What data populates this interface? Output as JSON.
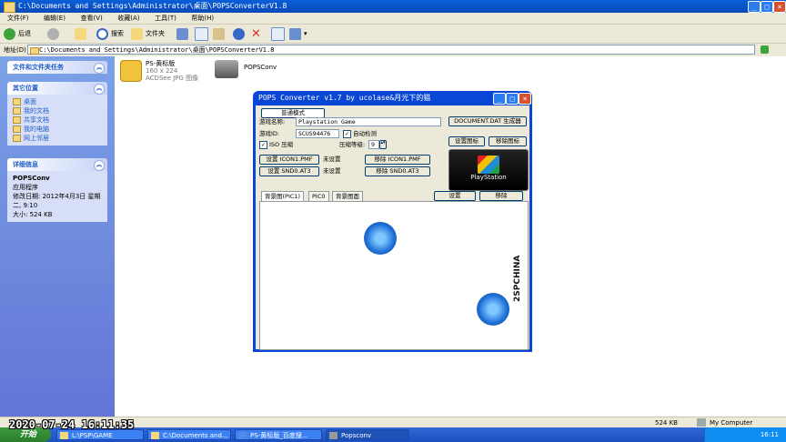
{
  "window": {
    "title": "C:\\Documents and Settings\\Administrator\\桌面\\POPSConverterV1.8"
  },
  "menu": [
    "文件(F)",
    "编辑(E)",
    "查看(V)",
    "收藏(A)",
    "工具(T)",
    "帮助(H)"
  ],
  "toolbar": {
    "back": "后退",
    "search": "搜索",
    "folders": "文件夹"
  },
  "address": {
    "label": "地址(D)",
    "value": "C:\\Documents and Settings\\Administrator\\桌面\\POPSConverterV1.8"
  },
  "left_panels": {
    "tasks_title": "文件和文件夹任务",
    "places_title": "其它位置",
    "places": [
      "桌面",
      "我的文档",
      "共享文档",
      "我的电脑",
      "网上邻居"
    ],
    "details_title": "详细信息",
    "details": {
      "name": "POPSConv",
      "type": "应用程序",
      "modified": "修改日期: 2012年4月3日 星期二, 9:10",
      "size": "大小: 524 KB"
    }
  },
  "files": [
    {
      "name": "PS-黄标版",
      "line2": "160 x 224",
      "line3": "ACDSee JPG 图像"
    },
    {
      "name": "POPSConv",
      "line2": "",
      "line3": ""
    }
  ],
  "statusbar": {
    "size": "524 KB",
    "location": "My Computer"
  },
  "taskbar": {
    "start": "开始",
    "tasks": [
      "L:\\PSP\\GAME",
      "C:\\Documents and...",
      "PS-黄标版_百度搜...",
      "Popsconv"
    ],
    "clock": "16:11"
  },
  "overlay_timestamp": "2020-07-24 16:11:35",
  "dialog": {
    "title": "POPS Converter v1.7 by ucolase&月光下的猫",
    "tab_basic": "普通模式",
    "name_label": "游戏名称:",
    "name_value": "Playstation Game",
    "doc_button": "DOCUMENT.DAT 生成器",
    "id_label": "游戏ID:",
    "id_value": "SCUS94476",
    "auto_detect": "自动检测",
    "set_icon": "设置图标",
    "remove_icon": "移除图标",
    "iso_compress": "ISO 压缩",
    "compress_level_label": "压缩等级:",
    "compress_level": "9",
    "set_icon1": "设置 ICON1.PMF",
    "not_set_1": "未设置",
    "remove_icon1": "移除 ICON1.PMF",
    "set_snd0": "设置 SND0.AT3",
    "not_set_2": "未设置",
    "remove_snd0": "移除 SND0.AT3",
    "tabs": [
      "背景图(PIC1)",
      "PIC0",
      "背景图面"
    ],
    "set_btn": "设置",
    "remove_btn": "移除",
    "ps_logo_text": "PlayStation",
    "watermark": "2SPCHINA"
  }
}
